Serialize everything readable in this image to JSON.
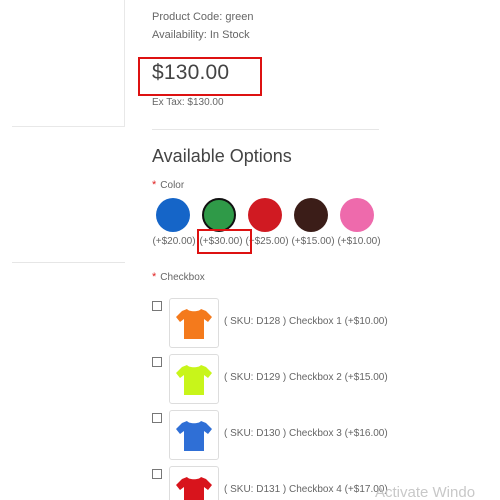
{
  "product": {
    "code_line": "Product Code: green",
    "availability_line": "Availability: In Stock",
    "price": "$130.00",
    "ex_tax": "Ex Tax: $130.00"
  },
  "options": {
    "heading": "Available Options",
    "color": {
      "required_marker": "*",
      "label": "Color",
      "swatches": [
        {
          "color": "#1565c8",
          "price": "(+$20.00)",
          "selected": false
        },
        {
          "color": "#2f9a48",
          "price": "(+$30.00)",
          "selected": true
        },
        {
          "color": "#d01a22",
          "price": "(+$25.00)",
          "selected": false
        },
        {
          "color": "#3b1d18",
          "price": "(+$15.00)",
          "selected": false
        },
        {
          "color": "#ee6aac",
          "price": "(+$10.00)",
          "selected": false
        }
      ]
    },
    "checkbox": {
      "required_marker": "*",
      "label": "Checkbox",
      "items": [
        {
          "text": "( SKU: D128 ) Checkbox 1 (+$10.00)",
          "shirt_color": "#f47a1c",
          "icon": "tshirt-icon"
        },
        {
          "text": "( SKU: D129 ) Checkbox 2 (+$15.00)",
          "shirt_color": "#c8f51a",
          "icon": "tshirt-icon"
        },
        {
          "text": "( SKU: D130 ) Checkbox 3 (+$16.00)",
          "shirt_color": "#2f6fd6",
          "icon": "tshirt-icon"
        },
        {
          "text": "( SKU: D131 ) Checkbox 4 (+$17.00)",
          "shirt_color": "#d8141c",
          "icon": "tshirt-icon"
        }
      ]
    }
  },
  "watermark": "Activate Windo",
  "colors": {
    "highlight_box": "#dd1111",
    "required_marker": "#e02020"
  }
}
